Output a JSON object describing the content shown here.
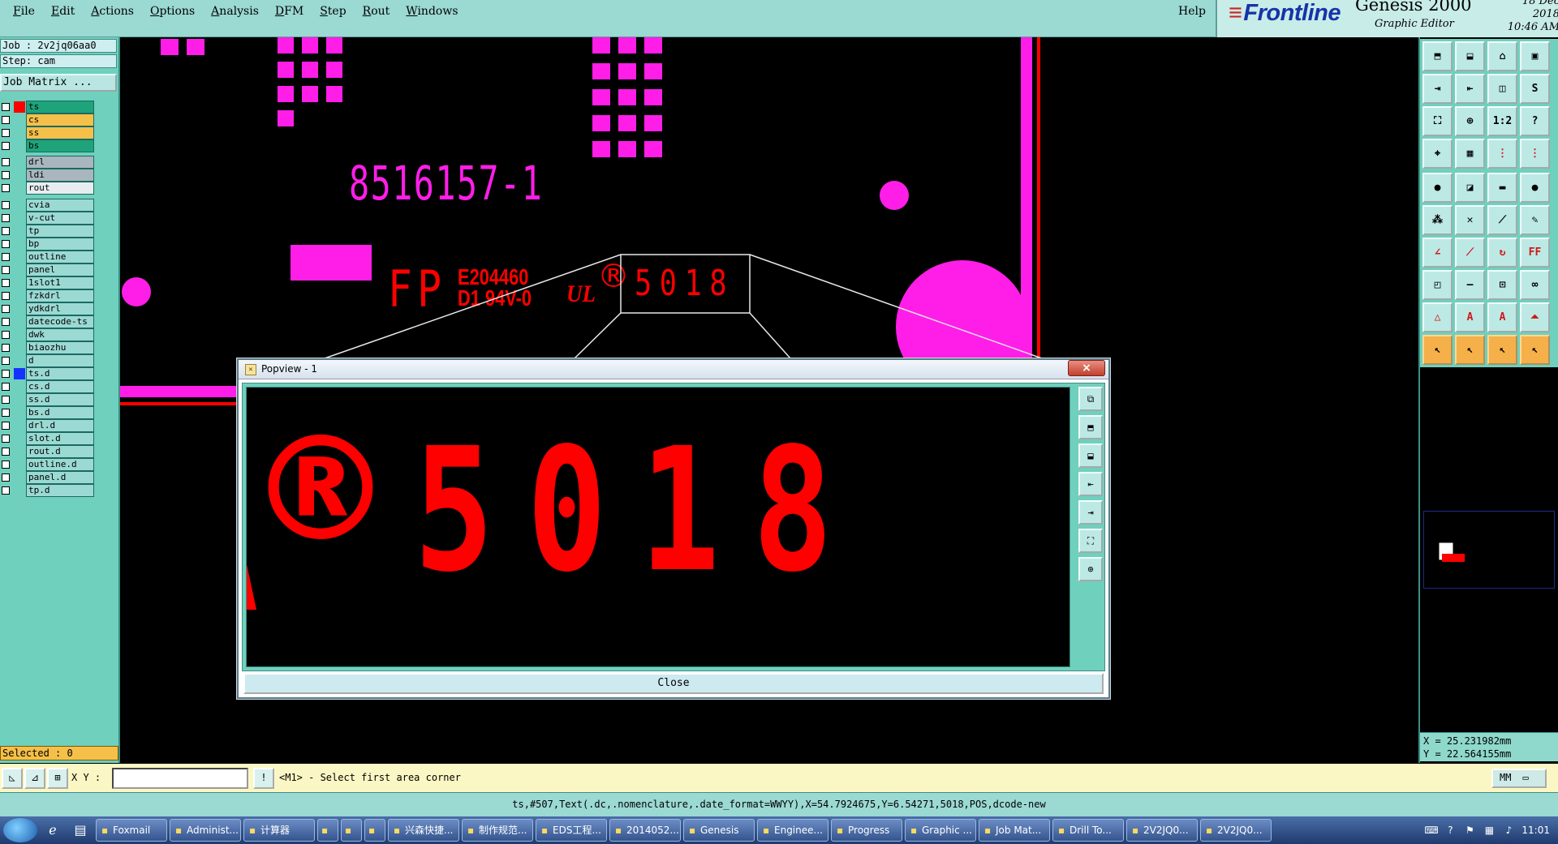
{
  "menu": {
    "items": [
      "File",
      "Edit",
      "Actions",
      "Options",
      "Analysis",
      "DFM",
      "Step",
      "Rout",
      "Windows"
    ],
    "help": "Help"
  },
  "brand": {
    "logo": "Frontline",
    "product": "Genesis 2000",
    "subtitle": "Graphic Editor",
    "date": "18 Dec 2018",
    "time": "10:46 AM"
  },
  "left_panel": {
    "job": "Job : 2v2jq06aa0",
    "step": "Step: cam",
    "job_matrix": "Job Matrix ...",
    "layers": {
      "board": [
        {
          "name": "ts",
          "color": "#1fa37a",
          "marker": "#ff0000"
        },
        {
          "name": "cs",
          "color": "#f5c04a"
        },
        {
          "name": "ss",
          "color": "#f5c04a"
        },
        {
          "name": "bs",
          "color": "#1fa37a"
        }
      ],
      "drill": [
        {
          "name": "drl",
          "color": "#a9b6bd"
        },
        {
          "name": "ldi",
          "color": "#a9b6bd"
        },
        {
          "name": "rout",
          "color": "#e6ecef"
        }
      ],
      "misc": [
        {
          "name": "cvia",
          "color": "#9bd9d3"
        },
        {
          "name": "v-cut",
          "color": "#9bd9d3"
        },
        {
          "name": "tp",
          "color": "#9bd9d3"
        },
        {
          "name": "bp",
          "color": "#9bd9d3"
        },
        {
          "name": "outline",
          "color": "#9bd9d3"
        },
        {
          "name": "panel",
          "color": "#9bd9d3"
        },
        {
          "name": "1slot1",
          "color": "#9bd9d3"
        },
        {
          "name": "fzkdrl",
          "color": "#9bd9d3"
        },
        {
          "name": "ydkdrl",
          "color": "#9bd9d3"
        },
        {
          "name": "datecode-ts",
          "color": "#9bd9d3"
        },
        {
          "name": "dwk",
          "color": "#9bd9d3"
        },
        {
          "name": "biaozhu",
          "color": "#9bd9d3"
        },
        {
          "name": "d",
          "color": "#9bd9d3"
        },
        {
          "name": "ts.d",
          "color": "#9bd9d3",
          "marker": "#1432ff"
        },
        {
          "name": "cs.d",
          "color": "#9bd9d3"
        },
        {
          "name": "ss.d",
          "color": "#9bd9d3"
        },
        {
          "name": "bs.d",
          "color": "#9bd9d3"
        },
        {
          "name": "drl.d",
          "color": "#9bd9d3"
        },
        {
          "name": "slot.d",
          "color": "#9bd9d3"
        },
        {
          "name": "rout.d",
          "color": "#9bd9d3"
        },
        {
          "name": "outline.d",
          "color": "#9bd9d3"
        },
        {
          "name": "panel.d",
          "color": "#9bd9d3"
        },
        {
          "name": "tp.d",
          "color": "#9bd9d3"
        }
      ]
    },
    "selected": "Selected : 0"
  },
  "canvas": {
    "part_number": "8516157-1",
    "fp": "FP",
    "ul_code_1": "E204460",
    "ul_code_2": "D1 94V-0",
    "ul_mark": "UL",
    "registered": "®",
    "datecode": "5018",
    "colors": {
      "primary": "#ff1ee8",
      "secondary": "#ff0000"
    }
  },
  "popview": {
    "title": "Popview - 1",
    "close_x": "×",
    "registered": "®",
    "datecode": "5018",
    "close_label": "Close"
  },
  "right_panel": {
    "tools_top": [
      "snapshot-icon",
      "import-icon",
      "home-icon",
      "layout-icon",
      "step-in-icon",
      "step-out-icon",
      "split-icon",
      "s-curve-icon",
      "zoom-fit-icon",
      "zoom-center-icon",
      "scale-1-2-icon",
      "help-icon",
      "measure-icon",
      "grid-icon",
      "route-icon",
      "lock-icon"
    ],
    "scale_label": "1:2",
    "help_label": "?",
    "tools_bottom": [
      "dot-icon",
      "flag-icon",
      "ruler-icon",
      "circle-icon",
      "nodes-icon",
      "cross-icon",
      "line-dot-icon",
      "pen-icon",
      "angle-icon",
      "slash-icon",
      "arc-icon",
      "ff-icon",
      "pad-icon",
      "minus-icon",
      "box-icon",
      "loops-icon",
      "triangle-small-icon",
      "triangle-a-icon",
      "triangle-red-icon",
      "triangle-flat-icon",
      "pointer-icon",
      "pointer-b-icon",
      "pointer-c-icon",
      "pointer-d-icon"
    ],
    "coords_x": "X = 25.231982mm",
    "coords_y": "Y = 22.564155mm"
  },
  "cmdbar": {
    "xy_label": "X Y :",
    "xy_value": "",
    "prompt": "<M1> - Select first area corner",
    "unit": "MM"
  },
  "statusbar": "ts,#507,Text(.dc,.nomenclature,.date_format=WWYY),X=54.7924675,Y=6.54271,5018,POS,dcode-new",
  "taskbar": {
    "tasks": [
      "Foxmail",
      "Administ...",
      "计算器",
      "",
      "",
      "",
      "兴森快捷...",
      "制作规范...",
      "EDS工程...",
      "2014052...",
      "Genesis",
      "Enginee...",
      "Progress",
      "Graphic ...",
      "Job Mat...",
      "Drill To...",
      "2V2JQ0...",
      "2V2JQ0..."
    ],
    "clock": "11:01"
  }
}
